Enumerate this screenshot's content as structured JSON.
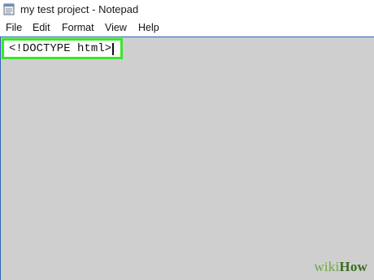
{
  "window": {
    "title": "my test project - Notepad",
    "icon": "notepad-icon"
  },
  "menu": {
    "items": [
      {
        "label": "File"
      },
      {
        "label": "Edit"
      },
      {
        "label": "Format"
      },
      {
        "label": "View"
      },
      {
        "label": "Help"
      }
    ]
  },
  "editor": {
    "text": "<!DOCTYPE html>",
    "highlight_color": "#3ae52d"
  },
  "watermark": {
    "part1": "wiki",
    "part2": "How"
  }
}
